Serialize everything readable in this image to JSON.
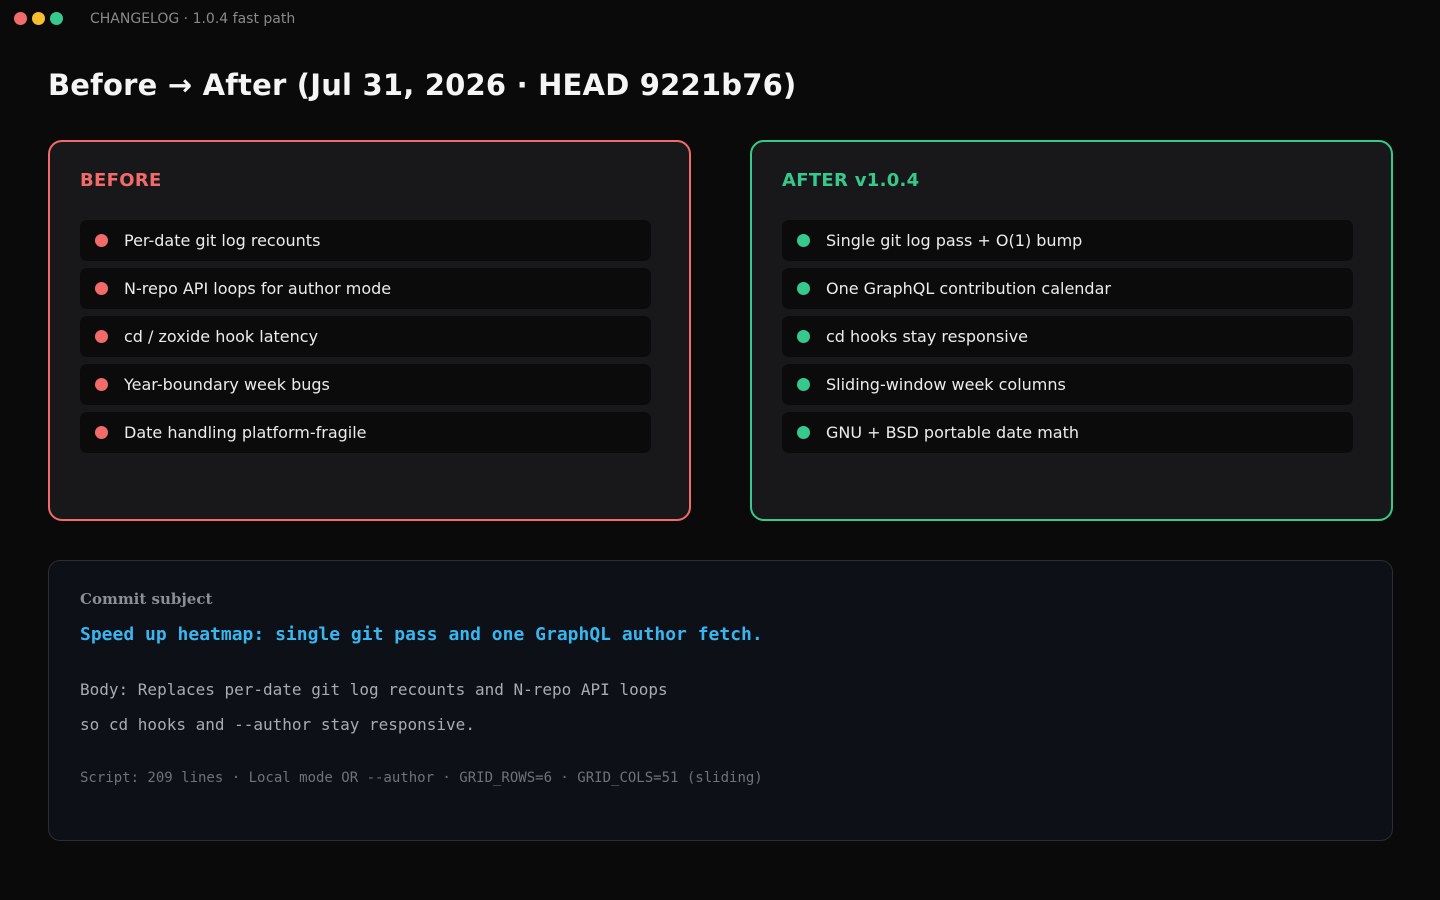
{
  "window": {
    "title": "CHANGELOG · 1.0.4 fast path",
    "controls": [
      {
        "name": "close-button",
        "color": "#f26b6b"
      },
      {
        "name": "minimize-button",
        "color": "#f5bd30"
      },
      {
        "name": "maximize-button",
        "color": "#36c98e"
      }
    ]
  },
  "page": {
    "title": "Before → After (Jul 31, 2026 · HEAD 9221b76)"
  },
  "before": {
    "label": "BEFORE",
    "accent": "#f26b6b",
    "items": [
      "Per-date git log recounts",
      "N-repo API loops for author mode",
      "cd / zoxide hook latency",
      "Year-boundary week bugs",
      "Date handling platform-fragile"
    ]
  },
  "after": {
    "label": "AFTER v1.0.4",
    "accent": "#36c98e",
    "items": [
      "Single git log pass + O(1) bump",
      "One GraphQL contribution calendar",
      "cd hooks stay responsive",
      "Sliding-window week columns",
      "GNU + BSD portable date math"
    ]
  },
  "commit": {
    "heading": "Commit subject",
    "subject": "Speed up heatmap: single git pass and one GraphQL author fetch.",
    "body_line_1": "Body: Replaces per-date git log recounts and N-repo API loops",
    "body_line_2": "so cd hooks and --author stay responsive.",
    "meta": "Script: 209 lines · Local mode OR --author · GRID_ROWS=6 · GRID_COLS=51 (sliding)",
    "subject_color": "#38b6f0"
  }
}
